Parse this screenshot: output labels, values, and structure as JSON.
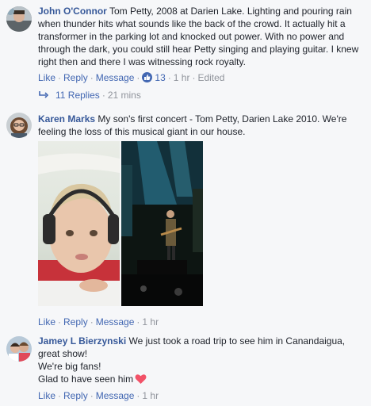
{
  "comments": [
    {
      "author": "John O'Connor",
      "text": "Tom Petty, 2008 at Darien Lake. Lighting and pouring rain when thunder hits what sounds like the back of the crowd. It actually hit a transformer in the parking lot and knocked out power. With no power and through the dark, you could still hear Petty singing and playing guitar. I knew right then and there I was witnessing rock royalty.",
      "like_label": "Like",
      "reply_label": "Reply",
      "message_label": "Message",
      "reaction_count": "13",
      "time": "1 hr",
      "edited": "Edited",
      "replies_label": "11 Replies",
      "replies_time": "21 mins"
    },
    {
      "author": "Karen Marks",
      "text": "My son's first concert - Tom Petty, Darien Lake 2010. We're feeling the loss of this musical giant in our house.",
      "like_label": "Like",
      "reply_label": "Reply",
      "message_label": "Message",
      "time": "1 hr"
    },
    {
      "author": "Jamey L Bierzynski",
      "text_line1": "We just took a road trip to see him in Canandaigua, great show!",
      "text_line2": "We're big fans!",
      "text_line3": "Glad to have seen him",
      "like_label": "Like",
      "reply_label": "Reply",
      "message_label": "Message",
      "time": "1 hr"
    }
  ],
  "icons": {
    "reaction": "like-thumb-icon",
    "replies": "reply-arrow-icon",
    "emoji": "heart-icon"
  },
  "colors": {
    "link": "#4267b2",
    "author": "#365899",
    "muted": "#90949c",
    "heart": "#f25268"
  }
}
